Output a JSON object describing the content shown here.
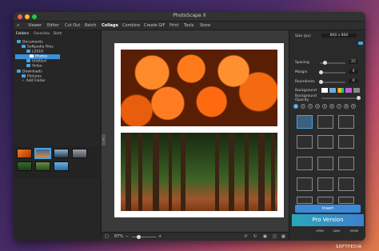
{
  "window": {
    "title": "PhotoScape X"
  },
  "menu": [
    {
      "label": "Viewer"
    },
    {
      "label": "Editor"
    },
    {
      "label": "Cut Out"
    },
    {
      "label": "Batch"
    },
    {
      "label": "Collage"
    },
    {
      "label": "Combine"
    },
    {
      "label": "Create GIF"
    },
    {
      "label": "Print"
    },
    {
      "label": "Tools"
    },
    {
      "label": "Store"
    }
  ],
  "left_panel": {
    "tabs": [
      "Folders",
      "Favorites",
      "Both"
    ],
    "tree": [
      "Documents",
      "Softpedia Files",
      "L2016",
      "Photos",
      "Untitled",
      "Video",
      "Downloads",
      "Pictures",
      "Add Folder"
    ]
  },
  "right_panel": {
    "size_label": "Size (px)",
    "size_value": "800 x 800",
    "spacing_label": "Spacing",
    "spacing_value": "25",
    "margin_label": "Margin",
    "margin_value": "0",
    "roundness_label": "Roundness",
    "roundness_value": "0",
    "background_label": "Background",
    "bg_opacity_label": "Background Opacity",
    "numbers": [
      "1",
      "2",
      "3",
      "4",
      "5",
      "6",
      "7",
      "8",
      "9"
    ],
    "insert_label": "Insert",
    "pro_label": "Pro Version",
    "bottom_labels": [
      "OPEN",
      "SAVE",
      "MORE"
    ]
  },
  "bottom": {
    "zoom": "87%"
  },
  "watermark": "SOFTPEDIA",
  "colors": {
    "accent": "#3a8ad8",
    "selected": "#4aa3e0"
  }
}
